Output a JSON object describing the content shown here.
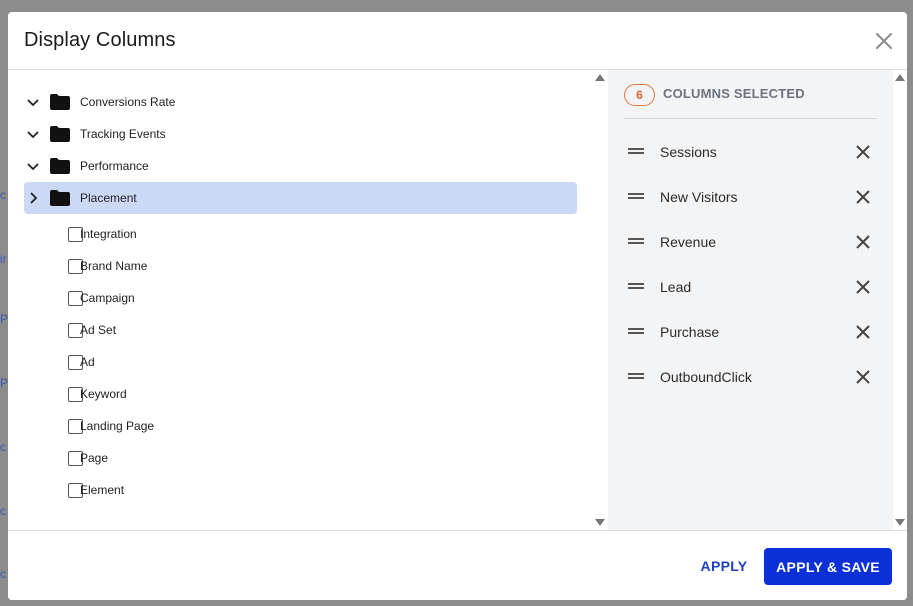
{
  "modal": {
    "title": "Display Columns"
  },
  "tree": {
    "folders": [
      {
        "label": "Conversions Rate",
        "expanded": true
      },
      {
        "label": "Tracking Events",
        "expanded": true
      },
      {
        "label": "Performance",
        "expanded": true
      },
      {
        "label": "Placement",
        "expanded": false,
        "highlighted": true
      }
    ],
    "columns": [
      {
        "label": "Integration",
        "checked": false
      },
      {
        "label": "Brand Name",
        "checked": false
      },
      {
        "label": "Campaign",
        "checked": false
      },
      {
        "label": "Ad Set",
        "checked": false
      },
      {
        "label": "Ad",
        "checked": false
      },
      {
        "label": "Keyword",
        "checked": false
      },
      {
        "label": "Landing Page",
        "checked": false
      },
      {
        "label": "Page",
        "checked": false
      },
      {
        "label": "Element",
        "checked": false
      }
    ]
  },
  "selected_panel": {
    "count": "6",
    "heading": "COLUMNS SELECTED",
    "items": [
      {
        "label": "Sessions"
      },
      {
        "label": "New Visitors"
      },
      {
        "label": "Revenue"
      },
      {
        "label": "Lead"
      },
      {
        "label": "Purchase"
      },
      {
        "label": "OutboundClick"
      }
    ]
  },
  "footer": {
    "apply_label": "APPLY",
    "apply_save_label": "APPLY & SAVE"
  },
  "colors": {
    "highlight": "#ccd9f6",
    "primary": "#0b30d8",
    "badge": "#e07a3c",
    "panel_bg": "#f3f4f6"
  }
}
